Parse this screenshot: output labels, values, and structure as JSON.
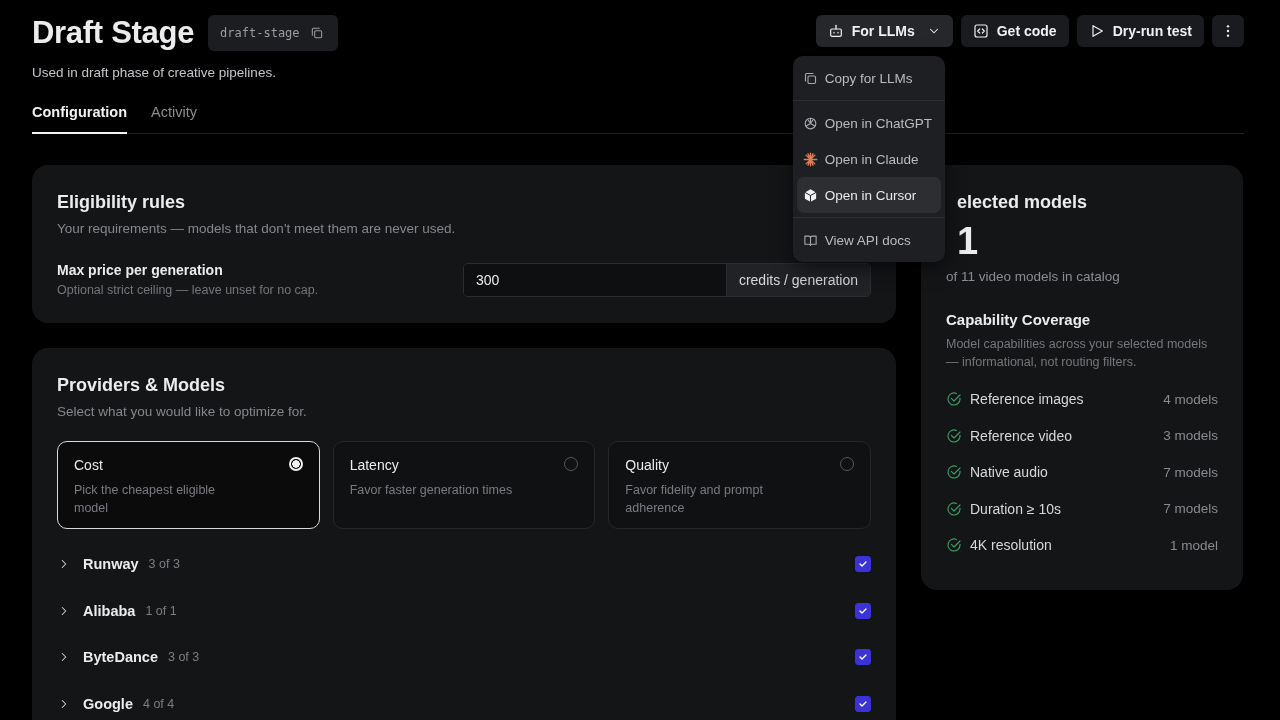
{
  "header": {
    "title": "Draft Stage",
    "slug": "draft-stage",
    "description": "Used in draft phase of creative pipelines."
  },
  "actions": [
    {
      "kind": "llm",
      "label": "For LLMs"
    },
    {
      "kind": "code",
      "label": "Get code"
    },
    {
      "kind": "run",
      "label": "Dry-run test"
    },
    {
      "kind": "more"
    }
  ],
  "menu": [
    {
      "kind": "copy",
      "label": "Copy for LLMs",
      "highlighted": false
    },
    {
      "kind": "chatgpt",
      "label": "Open in ChatGPT",
      "highlighted": false
    },
    {
      "kind": "claude",
      "label": "Open in Claude",
      "highlighted": false
    },
    {
      "kind": "cursor",
      "label": "Open in Cursor",
      "highlighted": true
    },
    {
      "kind": "docs",
      "label": "View API docs",
      "highlighted": false
    }
  ],
  "tabs": [
    {
      "label": "Configuration",
      "selected": true
    },
    {
      "label": "Activity",
      "selected": false
    }
  ],
  "eligibility": {
    "title": "Eligibility rules",
    "subtitle": "Your requirements — models that don't meet them are never used.",
    "field_label": "Max price per generation",
    "field_hint": "Optional strict ceiling — leave unset for no cap.",
    "value": "300",
    "unit": "credits / generation"
  },
  "providers": {
    "title": "Providers & Models",
    "subtitle": "Select what you would like to optimize for.",
    "options": [
      {
        "title": "Cost",
        "description": "Pick the cheapest eligible model",
        "selected": true
      },
      {
        "title": "Latency",
        "description": "Favor faster generation times",
        "selected": false
      },
      {
        "title": "Quality",
        "description": "Favor fidelity and prompt adherence",
        "selected": false
      }
    ],
    "items": [
      {
        "name": "Runway",
        "count": "3 of 3",
        "checked": true
      },
      {
        "name": "Alibaba",
        "count": "1 of 1",
        "checked": true
      },
      {
        "name": "ByteDance",
        "count": "3 of 3",
        "checked": true
      },
      {
        "name": "Google",
        "count": "4 of 4",
        "checked": true
      }
    ]
  },
  "summary": {
    "title": "elected models",
    "count": "1",
    "caption": "of 11 video models in catalog",
    "coverage_title": "Capability Coverage",
    "coverage_subtitle": "Model capabilities across your selected models — informational, not routing filters.",
    "capabilities": [
      {
        "label": "Reference images",
        "count": "4 models"
      },
      {
        "label": "Reference video",
        "count": "3 models"
      },
      {
        "label": "Native audio",
        "count": "7 models"
      },
      {
        "label": "Duration ≥ 10s",
        "count": "7 models"
      },
      {
        "label": "4K resolution",
        "count": "1 model"
      }
    ]
  }
}
